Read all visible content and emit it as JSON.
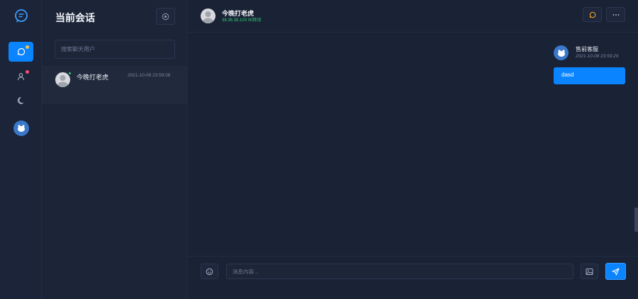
{
  "sidebar": {
    "nav": [
      {
        "name": "chat",
        "active": true,
        "badge_color": "#f5c542"
      },
      {
        "name": "contacts",
        "active": false,
        "badge_color": "#ff4d6d"
      },
      {
        "name": "theme",
        "active": false
      }
    ]
  },
  "conversation_list": {
    "title": "当前会话",
    "search_placeholder": "搜索聊天用户",
    "items": [
      {
        "name": "今晚打老虎",
        "time": "2021-10-08 23:59:08",
        "online": true
      }
    ]
  },
  "chat": {
    "header": {
      "name": "今晚打老虎",
      "status": "38.36.38.103 00移动"
    },
    "messages": [
      {
        "sender": "售前客服",
        "time": "2021-10-08 23:59:29",
        "text": "dasd"
      }
    ],
    "input_placeholder": "消息内容..."
  },
  "colors": {
    "accent": "#0a84ff",
    "online": "#2ecc71",
    "background": "#1a2236"
  }
}
